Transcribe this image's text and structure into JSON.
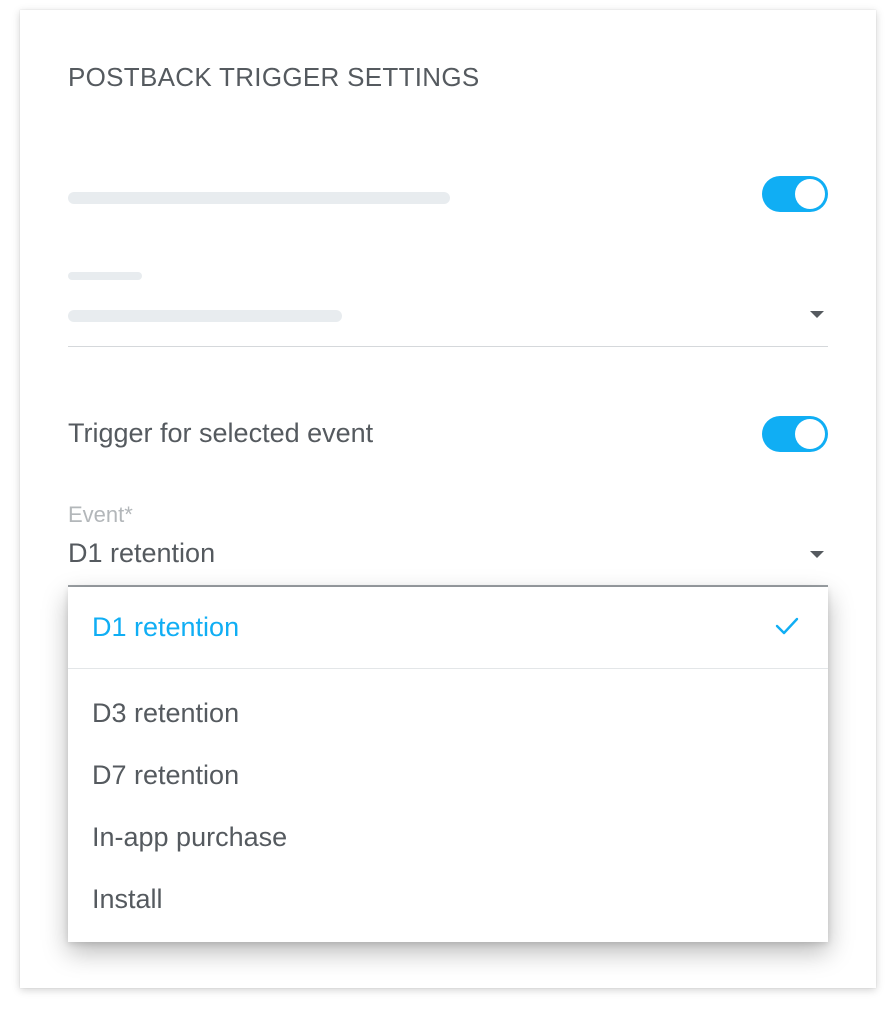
{
  "panel": {
    "title": "POSTBACK TRIGGER SETTINGS"
  },
  "toggles": {
    "first_enabled": true,
    "selected_event_enabled": true
  },
  "trigger_row": {
    "label": "Trigger for selected event"
  },
  "event_select": {
    "label": "Event*",
    "value": "D1 retention",
    "options": [
      {
        "label": "D1 retention",
        "selected": true
      },
      {
        "label": "D3 retention",
        "selected": false
      },
      {
        "label": "D7 retention",
        "selected": false
      },
      {
        "label": "In-app purchase",
        "selected": false
      },
      {
        "label": "Install",
        "selected": false
      }
    ]
  },
  "colors": {
    "accent": "#10aef4",
    "text": "#555a5f",
    "muted": "#b3b7ba",
    "skeleton": "#e8ecef"
  },
  "icons": {
    "toggle": "toggle-switch",
    "caret": "caret-down-icon",
    "check": "check-icon"
  }
}
